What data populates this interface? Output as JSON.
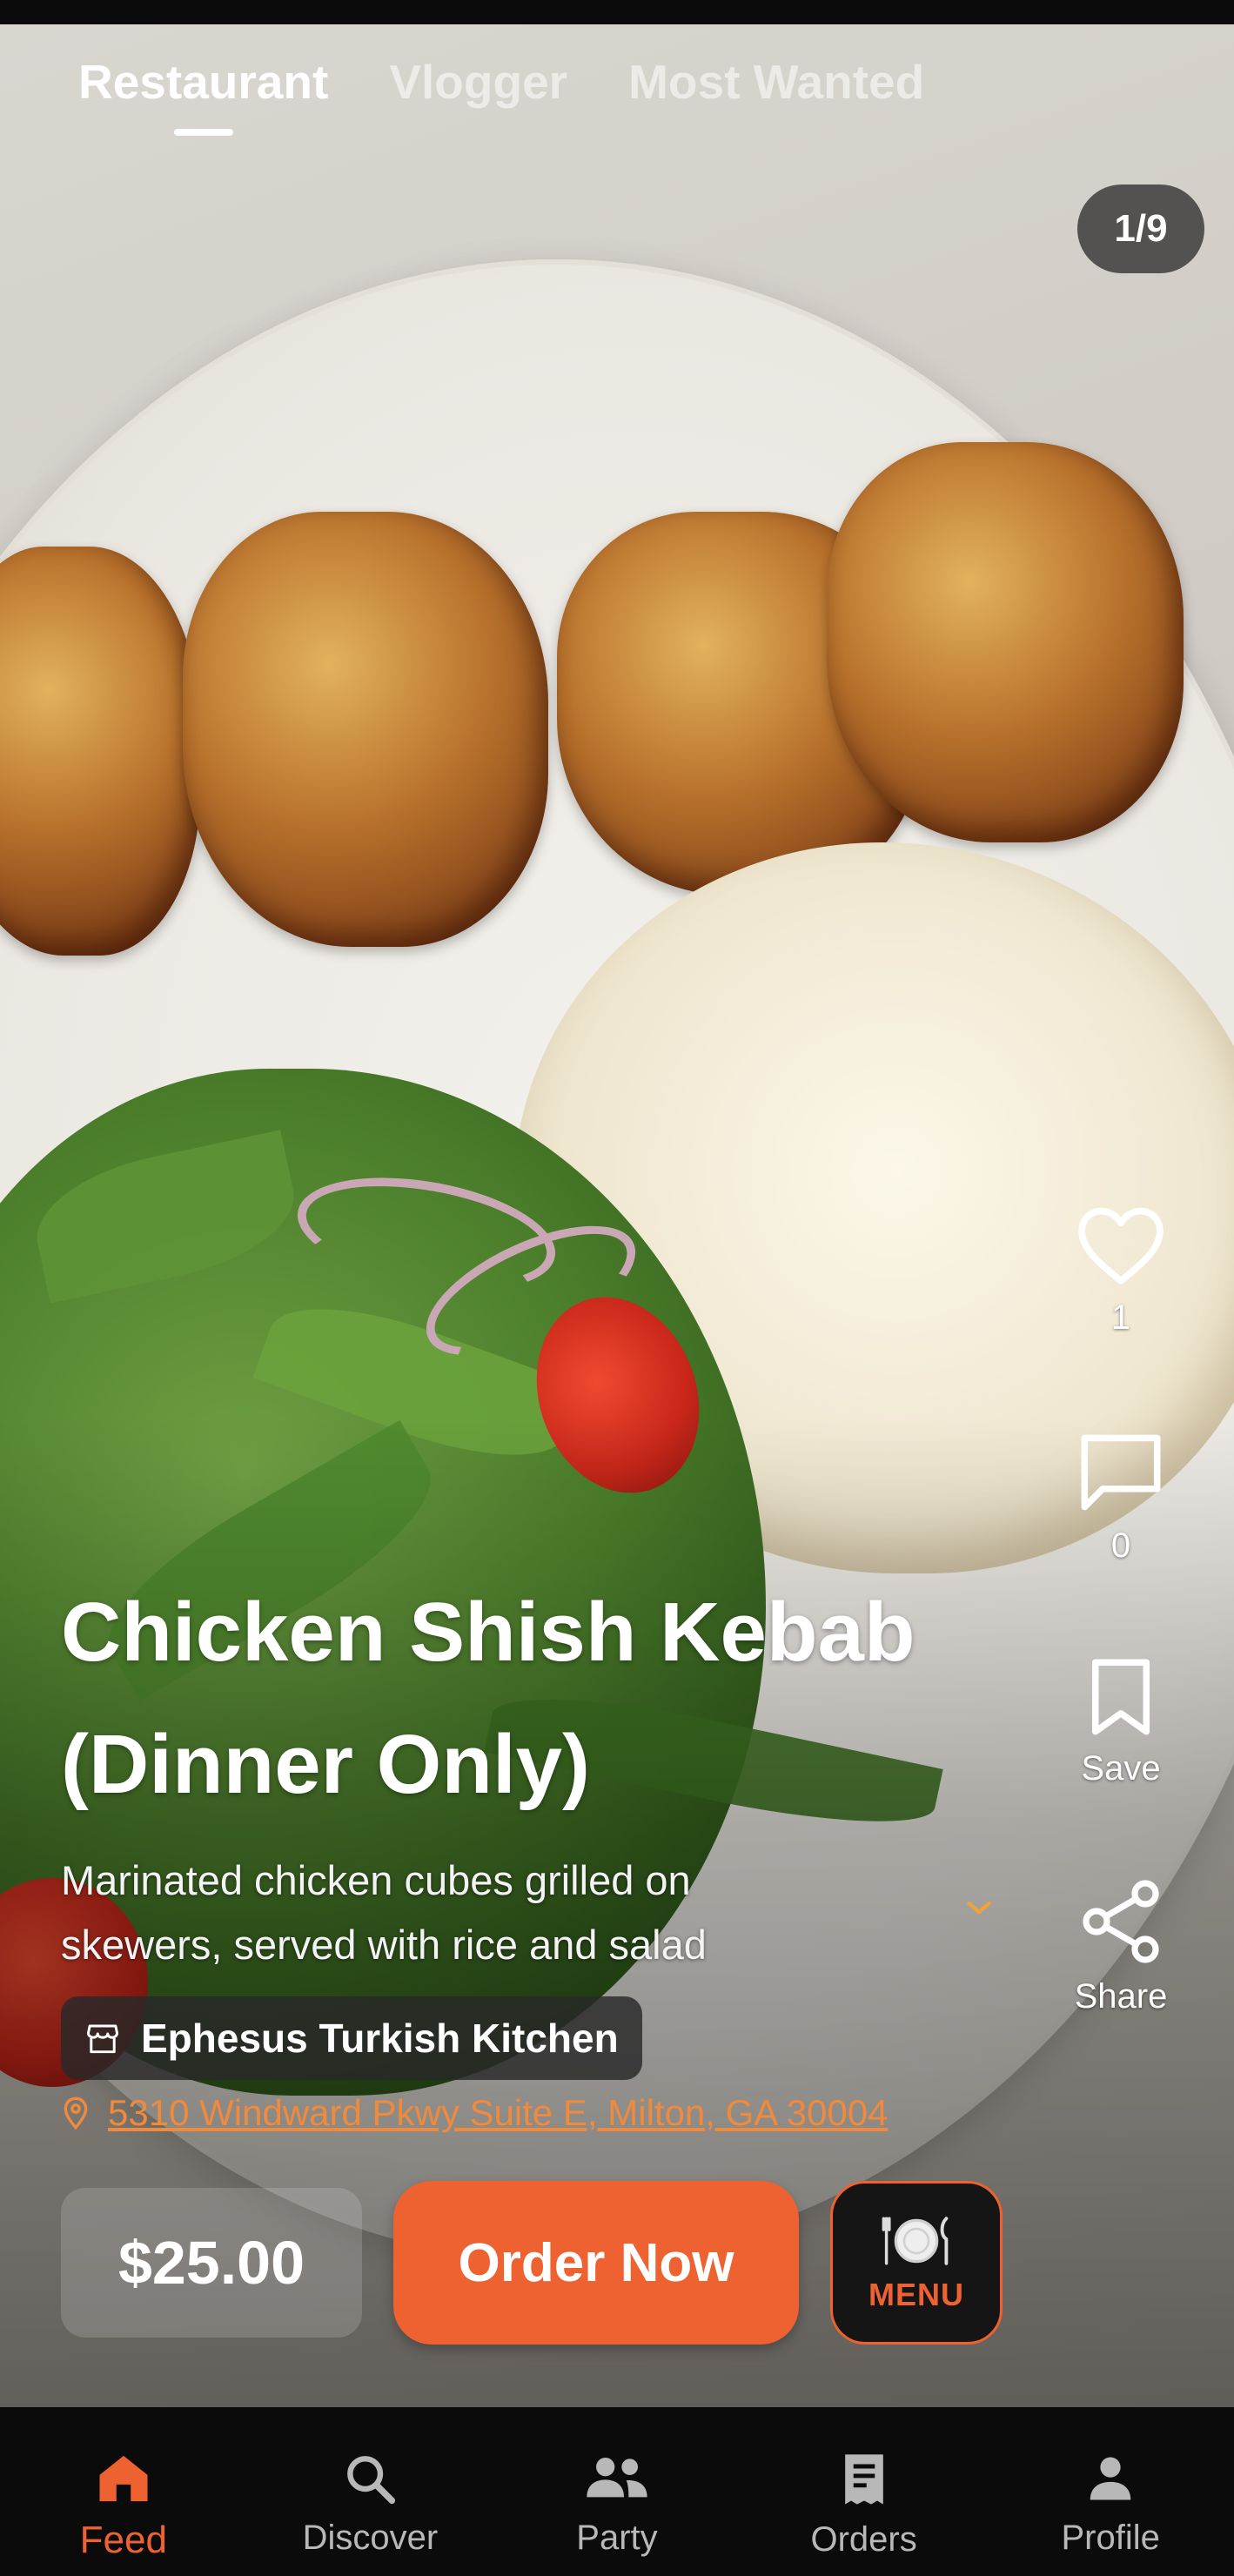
{
  "tabs": [
    {
      "label": "Restaurant",
      "active": true
    },
    {
      "label": "Vlogger",
      "active": false
    },
    {
      "label": "Most Wanted",
      "active": false
    }
  ],
  "media_counter": "1/9",
  "actions": {
    "like": {
      "icon": "heart-icon",
      "count": "1"
    },
    "comment": {
      "icon": "comment-icon",
      "count": "0"
    },
    "save": {
      "icon": "bookmark-icon",
      "label": "Save"
    },
    "share": {
      "icon": "share-icon",
      "label": "Share"
    }
  },
  "dish": {
    "title": "Chicken Shish Kebab (Dinner Only)",
    "description": "Marinated chicken cubes grilled on skewers, served with rice and salad"
  },
  "restaurant": {
    "icon": "store-icon",
    "name": "Ephesus Turkish Kitchen",
    "address_icon": "location-pin-icon",
    "address": "5310 Windward Pkwy Suite E, Milton, GA 30004"
  },
  "purchase": {
    "price": "$25.00",
    "order_label": "Order Now",
    "menu_label": "MENU",
    "menu_icon": "plate-cutlery-icon"
  },
  "bottom_nav": [
    {
      "label": "Feed",
      "icon": "home-icon",
      "active": true
    },
    {
      "label": "Discover",
      "icon": "search-icon",
      "active": false
    },
    {
      "label": "Party",
      "icon": "people-icon",
      "active": false
    },
    {
      "label": "Orders",
      "icon": "receipt-icon",
      "active": false
    },
    {
      "label": "Profile",
      "icon": "person-icon",
      "active": false
    }
  ],
  "colors": {
    "accent": "#ee6130",
    "address": "#f08a3c",
    "nav_background": "#0b0b0b"
  }
}
